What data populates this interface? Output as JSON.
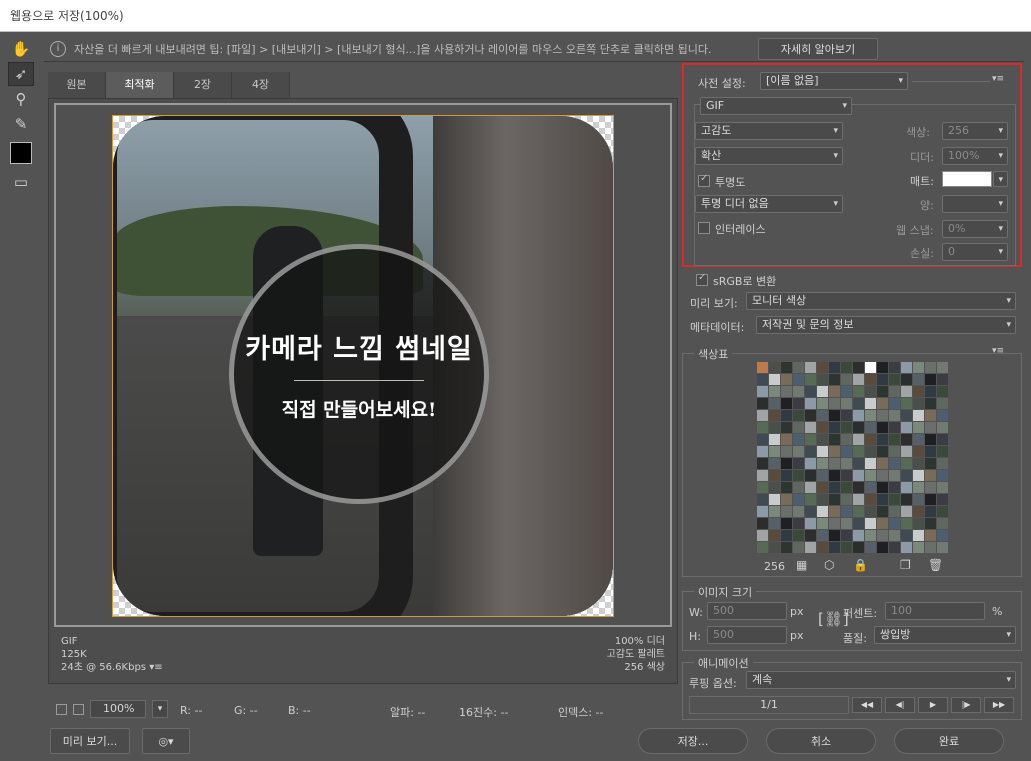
{
  "window": {
    "title": "웹용으로 저장(100%)"
  },
  "tools": [
    {
      "name": "hand-tool-icon",
      "glyph": "✋"
    },
    {
      "name": "slice-select-tool-icon",
      "glyph": "➶"
    },
    {
      "name": "zoom-tool-icon",
      "glyph": "🔍"
    },
    {
      "name": "eyedropper-tool-icon",
      "glyph": "✎"
    }
  ],
  "tip": {
    "text": "자산을 더 빠르게 내보내려면 팁: [파일] > [내보내기] > [내보내기 형식...]을 사용하거나 레이어를 마우스 오른쪽 단추로 클릭하면 됩니다.",
    "learn_more": "자세히 알아보기"
  },
  "tabs": [
    "원본",
    "최적화",
    "2장",
    "4장"
  ],
  "active_tab": "최적화",
  "image_text": {
    "headline": "카메라 느낌 썸네일",
    "subline": "직접 만들어보세요!"
  },
  "status": {
    "format": "GIF",
    "size": "125K",
    "time": "24초 @ 56.6Kbps",
    "dither_pct": "100% 디더",
    "palette": "고감도 팔레트",
    "colors": "256 색상"
  },
  "bottom": {
    "zoom": "100%",
    "r": "R: --",
    "g": "G: --",
    "b": "B: --",
    "alpha": "알파: --",
    "hex": "16진수: --",
    "index": "인덱스: --",
    "preview_btn": "미리 보기...",
    "save_btn": "저장...",
    "cancel_btn": "취소",
    "done_btn": "완료"
  },
  "preset": {
    "label": "사전 설정:",
    "value": "[이름 없음]",
    "format": "GIF",
    "reduction": "고감도",
    "dither_algo": "확산",
    "transparency_label": "투명도",
    "transparency_dither": "투명 디더 없음",
    "interlace_label": "인터레이스",
    "colors_label": "색상:",
    "colors_value": "256",
    "dither_label": "디더:",
    "dither_value": "100%",
    "matte_label": "매트:",
    "amount_label": "양:",
    "web_snap_label": "웹 스냅:",
    "web_snap_value": "0%",
    "lossy_label": "손실:",
    "lossy_value": "0"
  },
  "convert": {
    "srgb_label": "sRGB로 변환",
    "preview_label": "미리 보기:",
    "preview_value": "모니터 색상",
    "metadata_label": "메타데이터:",
    "metadata_value": "저작권 및 문의 정보"
  },
  "color_table": {
    "title": "색상표",
    "count": "256"
  },
  "image_size": {
    "title": "이미지 크기",
    "w_label": "W:",
    "w_value": "500",
    "h_label": "H:",
    "h_value": "500",
    "unit": "px",
    "percent_label": "퍼센트:",
    "percent_value": "100",
    "percent_unit": "%",
    "quality_label": "품질:",
    "quality_value": "쌍입방"
  },
  "animation": {
    "title": "애니메이션",
    "loop_label": "루핑 옵션:",
    "loop_value": "계속",
    "frame": "1/1"
  },
  "colors": {
    "highlight": "#e0272a",
    "image_border": "#d39a36"
  }
}
